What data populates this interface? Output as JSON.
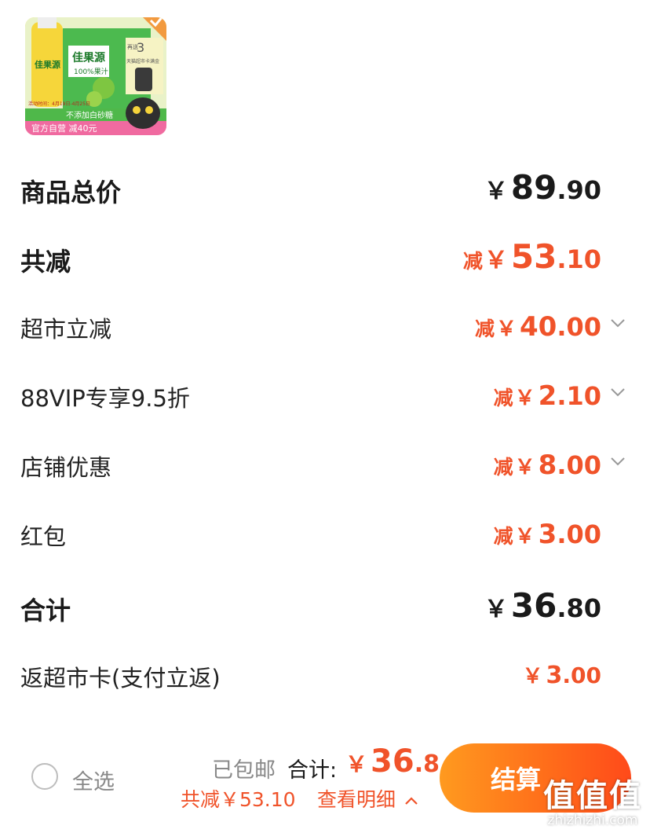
{
  "product": {
    "brand_text": "佳果源",
    "sub_text": "100%果汁",
    "promo_date": "活动时间：4月19日-4月25日",
    "banner_no_sugar": "不添加白砂糖",
    "banner_bottom": "官方自营 减40元",
    "side_tag_top": "再送",
    "side_tag_num": "3",
    "side_tag_text": "天猫超市卡满金"
  },
  "summary": {
    "total_price": {
      "label": "商品总价",
      "yen": "￥",
      "int": "89",
      "dec": ".90"
    },
    "total_discount": {
      "label": "共减",
      "cut": "减",
      "yen": "￥",
      "int": "53",
      "dec": ".10"
    },
    "discounts": [
      {
        "label": "超市立减",
        "cut": "减",
        "yen": "￥",
        "int": "40",
        "dec": ".00",
        "expandable": true
      },
      {
        "label": "88VIP专享9.5折",
        "cut": "减",
        "yen": "￥",
        "int": "2",
        "dec": ".10",
        "expandable": true
      },
      {
        "label": "店铺优惠",
        "cut": "减",
        "yen": "￥",
        "int": "8",
        "dec": ".00",
        "expandable": true
      },
      {
        "label": "红包",
        "cut": "减",
        "yen": "￥",
        "int": "3",
        "dec": ".00",
        "expandable": false
      }
    ],
    "grand_total": {
      "label": "合计",
      "yen": "￥",
      "int": "36",
      "dec": ".80"
    },
    "cashback": {
      "label": "返超市卡(支付立返)",
      "yen": "￥",
      "int": "3",
      "dec": ".00"
    }
  },
  "bottom_bar": {
    "select_all": "全选",
    "shipping": "已包邮",
    "total_label": "合计:",
    "total_yen": "￥",
    "total_int": "36",
    "total_dec": ".8",
    "saved_text": "共减￥53.10",
    "detail_link": "查看明细",
    "checkout": "结算"
  },
  "watermark": {
    "logo": "值值值",
    "url": "zhizhizhi.com"
  },
  "colors": {
    "accent": "#f0532a",
    "checkout_start": "#ff9a1f",
    "checkout_end": "#ff4a1a"
  }
}
